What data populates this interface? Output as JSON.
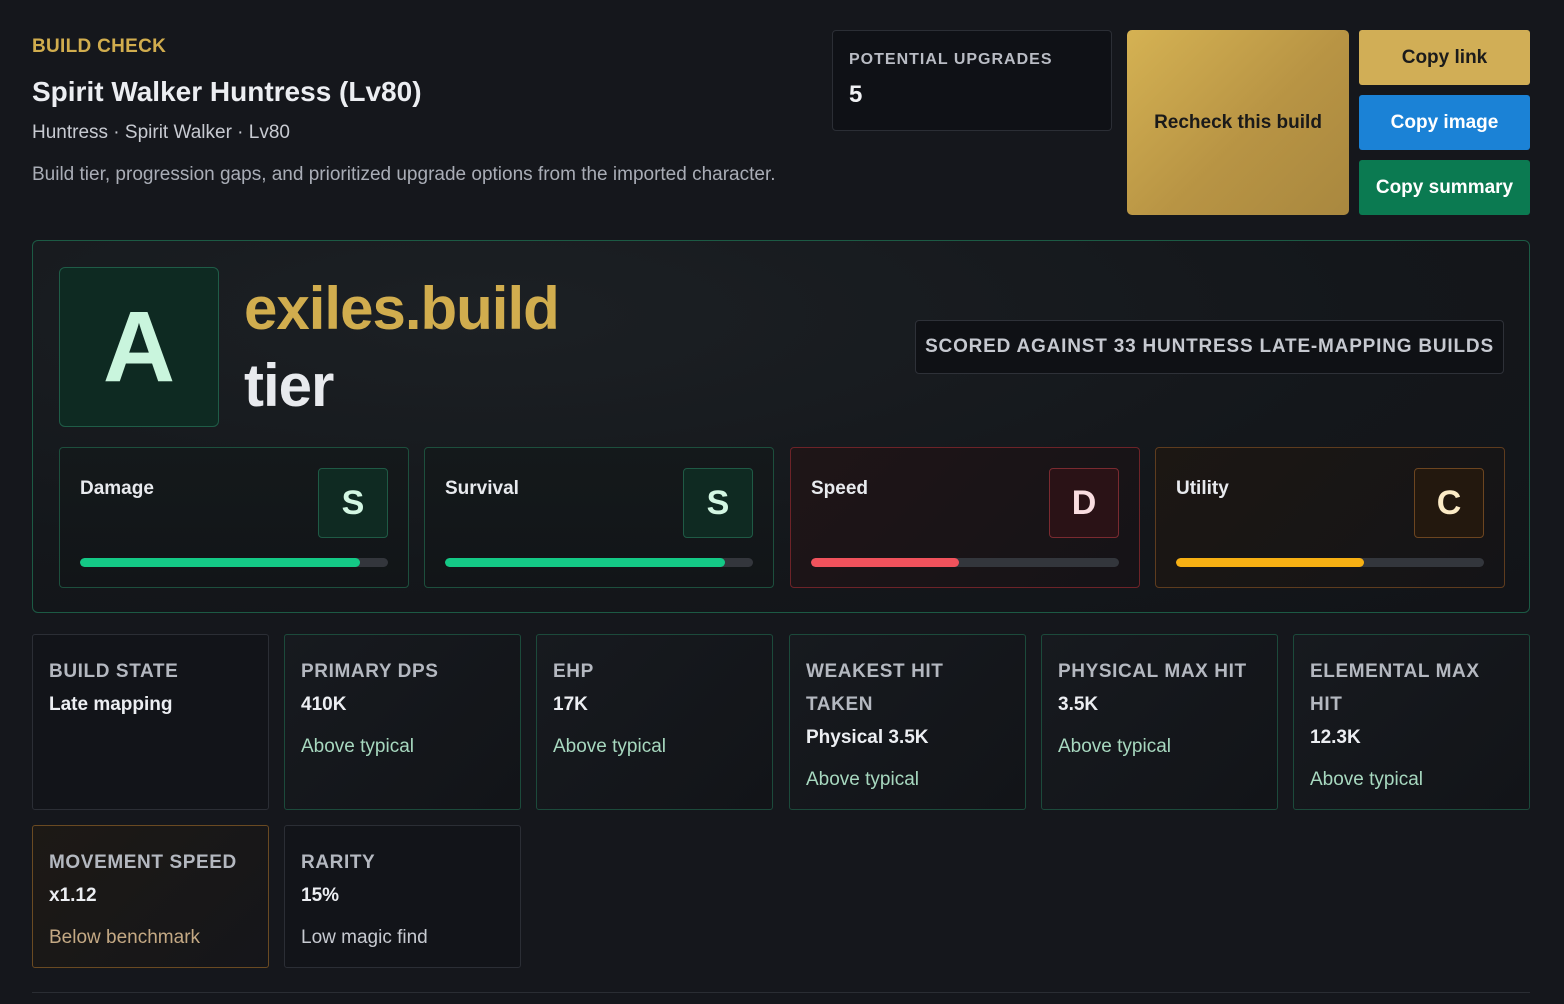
{
  "header": {
    "eyebrow": "BUILD CHECK",
    "title": "Spirit Walker Huntress (Lv80)",
    "subtitle": "Huntress · Spirit Walker · Lv80",
    "description": "Build tier, progression gaps, and prioritized upgrade options from the imported character."
  },
  "upgrades": {
    "label": "POTENTIAL UPGRADES",
    "value": "5"
  },
  "actions": {
    "recheck": "Recheck this build",
    "copy_link": "Copy link",
    "copy_image": "Copy image",
    "copy_summary": "Copy summary"
  },
  "tier": {
    "grade": "A",
    "brand": "exiles.build",
    "word": "tier",
    "scored_against": "SCORED AGAINST 33 HUNTRESS LATE-MAPPING BUILDS",
    "categories": [
      {
        "name": "Damage",
        "grade": "S",
        "progress": 0.91,
        "tone": "green"
      },
      {
        "name": "Survival",
        "grade": "S",
        "progress": 0.91,
        "tone": "green"
      },
      {
        "name": "Speed",
        "grade": "D",
        "progress": 0.48,
        "tone": "red"
      },
      {
        "name": "Utility",
        "grade": "C",
        "progress": 0.61,
        "tone": "amber"
      }
    ],
    "colors": {
      "green": "#14c986",
      "red": "#f0525c",
      "amber": "#f7b013",
      "gold": "#d1ad4e"
    }
  },
  "stats": [
    {
      "label": "BUILD STATE",
      "value": "Late mapping",
      "note": ""
    },
    {
      "label": "PRIMARY DPS",
      "value": "410K",
      "note": "Above typical"
    },
    {
      "label": "EHP",
      "value": "17K",
      "note": "Above typical"
    },
    {
      "label": "WEAKEST HIT TAKEN",
      "value": "Physical 3.5K",
      "note": "Above typical"
    },
    {
      "label": "PHYSICAL MAX HIT",
      "value": "3.5K",
      "note": "Above typical"
    },
    {
      "label": "ELEMENTAL MAX HIT",
      "value": "12.3K",
      "note": "Above typical"
    },
    {
      "label": "MOVEMENT SPEED",
      "value": "x1.12",
      "note": "Below benchmark"
    },
    {
      "label": "RARITY",
      "value": "15%",
      "note": "Low magic find"
    }
  ]
}
